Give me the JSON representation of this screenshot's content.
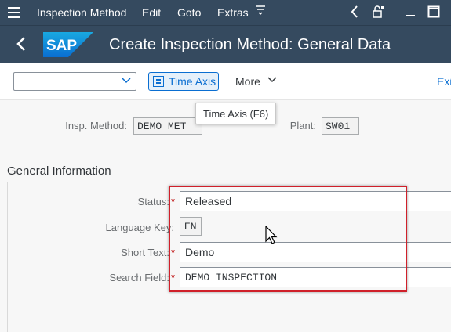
{
  "menubar": {
    "items": [
      "Inspection Method",
      "Edit",
      "Goto",
      "Extras"
    ],
    "icons": [
      "menu-icon",
      "overflow-icon",
      "back-arrow-icon",
      "lock-icon",
      "minimize-icon",
      "maximize-icon"
    ]
  },
  "titlebar": {
    "logo_text": "SAP",
    "title": "Create Inspection Method: General Data"
  },
  "toolbar": {
    "dropdown_value": "",
    "time_axis_label": "Time Axis",
    "more_label": "More",
    "exit_label": "Exi"
  },
  "tooltip": {
    "text": "Time Axis   (F6)"
  },
  "header": {
    "insp_method_label": "Insp. Method:",
    "insp_method_value": "DEMO MET",
    "plant_label": "Plant:",
    "plant_value": "SW01"
  },
  "general_info": {
    "title": "General Information",
    "status_label": "Status:",
    "status_value": "Released",
    "language_label": "Language Key:",
    "language_value": "EN",
    "short_text_label": "Short Text:",
    "short_text_value": "Demo",
    "search_field_label": "Search Field:",
    "search_field_value": "DEMO INSPECTION",
    "required_marker": "*"
  },
  "colors": {
    "shell": "#354a5f",
    "accent": "#0a6ed1",
    "highlight": "#d0202a",
    "required": "#bb0000"
  }
}
